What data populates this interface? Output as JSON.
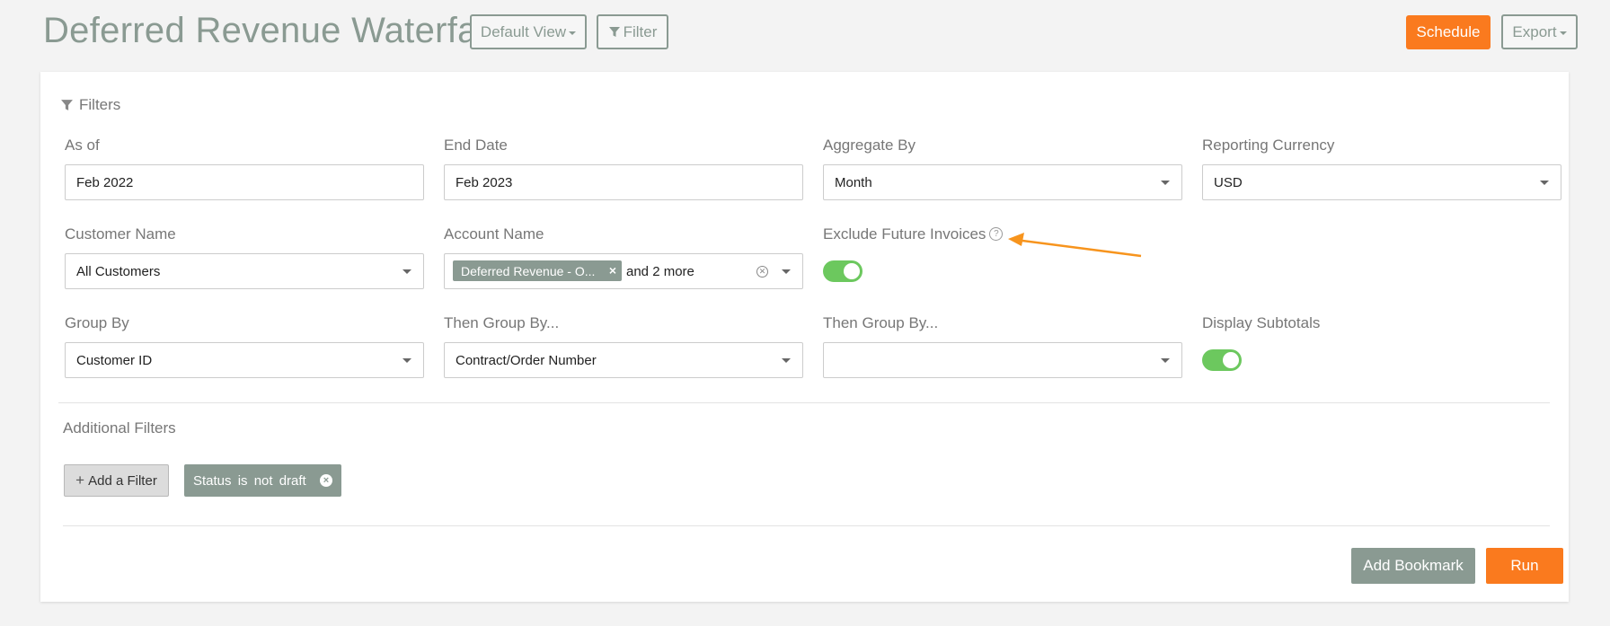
{
  "header": {
    "title": "Deferred Revenue Waterfall",
    "view_label": "Default View",
    "filter_label": "Filter",
    "schedule_label": "Schedule",
    "export_label": "Export"
  },
  "filters": {
    "heading": "Filters",
    "as_of": {
      "label": "As of",
      "value": "Feb 2022"
    },
    "end_date": {
      "label": "End Date",
      "value": "Feb 2023"
    },
    "aggregate_by": {
      "label": "Aggregate By",
      "value": "Month"
    },
    "reporting_currency": {
      "label": "Reporting Currency",
      "value": "USD"
    },
    "customer_name": {
      "label": "Customer Name",
      "value": "All Customers"
    },
    "account_name": {
      "label": "Account Name",
      "tag": "Deferred Revenue - O...",
      "tag_remove": "×",
      "more": "and 2 more"
    },
    "exclude_future_invoices": {
      "label": "Exclude Future Invoices",
      "help": "?",
      "enabled": true
    },
    "group_by": {
      "label": "Group By",
      "value": "Customer ID"
    },
    "then_group_by_1": {
      "label": "Then Group By...",
      "value": "Contract/Order Number"
    },
    "then_group_by_2": {
      "label": "Then Group By...",
      "value": ""
    },
    "display_subtotals": {
      "label": "Display Subtotals",
      "enabled": true
    }
  },
  "additional_filters": {
    "heading": "Additional Filters",
    "add_label": "Add a Filter",
    "chip_label": "Status is not draft",
    "chip_remove": "×"
  },
  "footer": {
    "bookmark_label": "Add Bookmark",
    "run_label": "Run"
  },
  "colors": {
    "accent_orange": "#fa7a1e",
    "muted_green_gray": "#8a9a92",
    "toggle_on": "#6cc85e",
    "annotation_arrow": "#f7941d"
  }
}
